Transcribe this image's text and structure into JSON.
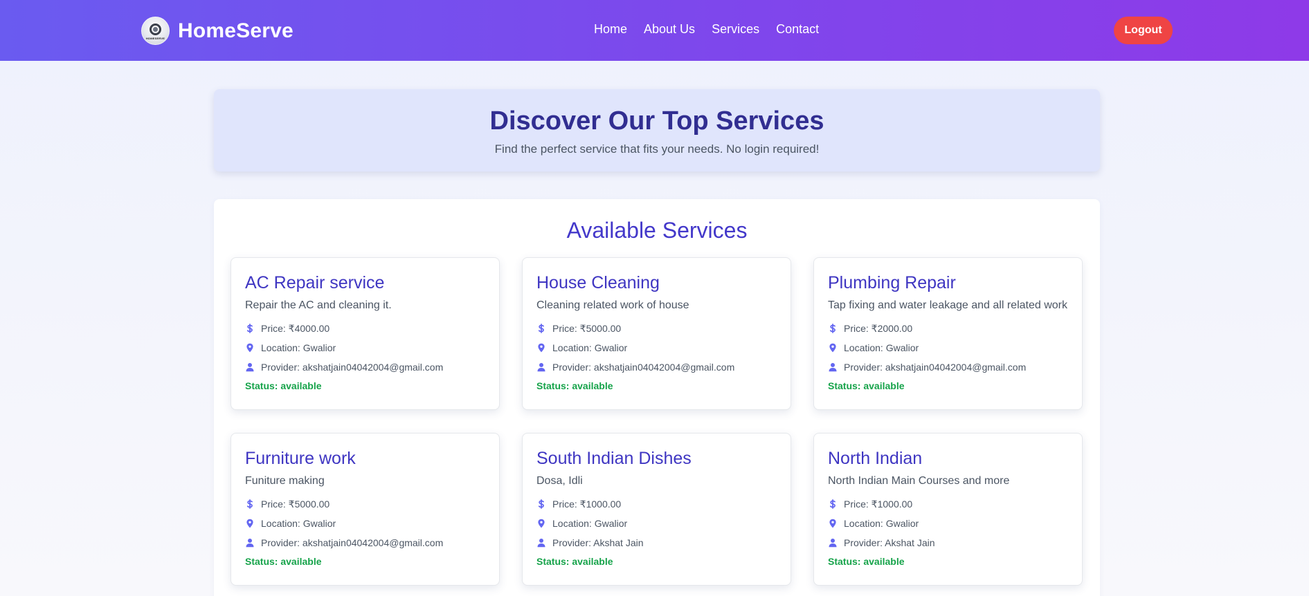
{
  "navbar": {
    "brand": "HomeServe",
    "logo_text": "HOMESERVE",
    "links": [
      "Home",
      "About Us",
      "Services",
      "Contact"
    ],
    "logout_label": "Logout"
  },
  "hero": {
    "title": "Discover Our Top Services",
    "subtitle": "Find the perfect service that fits your needs. No login required!"
  },
  "services_section": {
    "title": "Available Services",
    "cards": [
      {
        "title": "AC Repair service",
        "description": "Repair the AC and cleaning it.",
        "price": "Price: ₹4000.00",
        "location": "Location: Gwalior",
        "provider": "Provider: akshatjain04042004@gmail.com",
        "status": "Status: available"
      },
      {
        "title": "House Cleaning",
        "description": "Cleaning related work of house",
        "price": "Price: ₹5000.00",
        "location": "Location: Gwalior",
        "provider": "Provider: akshatjain04042004@gmail.com",
        "status": "Status: available"
      },
      {
        "title": "Plumbing Repair",
        "description": "Tap fixing and water leakage and all related work",
        "price": "Price: ₹2000.00",
        "location": "Location: Gwalior",
        "provider": "Provider: akshatjain04042004@gmail.com",
        "status": "Status: available"
      },
      {
        "title": "Furniture work",
        "description": "Funiture making",
        "price": "Price: ₹5000.00",
        "location": "Location: Gwalior",
        "provider": "Provider: akshatjain04042004@gmail.com",
        "status": "Status: available"
      },
      {
        "title": "South Indian Dishes",
        "description": "Dosa, Idli",
        "price": "Price: ₹1000.00",
        "location": "Location: Gwalior",
        "provider": "Provider: Akshat Jain",
        "status": "Status: available"
      },
      {
        "title": "North Indian",
        "description": "North Indian Main Courses and more",
        "price": "Price: ₹1000.00",
        "location": "Location: Gwalior",
        "provider": "Provider: Akshat Jain",
        "status": "Status: available"
      }
    ]
  },
  "icons": {
    "price": "dollar-icon",
    "location": "map-pin-icon",
    "provider": "user-icon"
  },
  "colors": {
    "nav_gradient_start": "#6a5bf0",
    "nav_gradient_end": "#8e3ae8",
    "logout": "#ef4444",
    "accent": "#4338ca",
    "status": "#16a34a",
    "icon": "#6366f1"
  }
}
